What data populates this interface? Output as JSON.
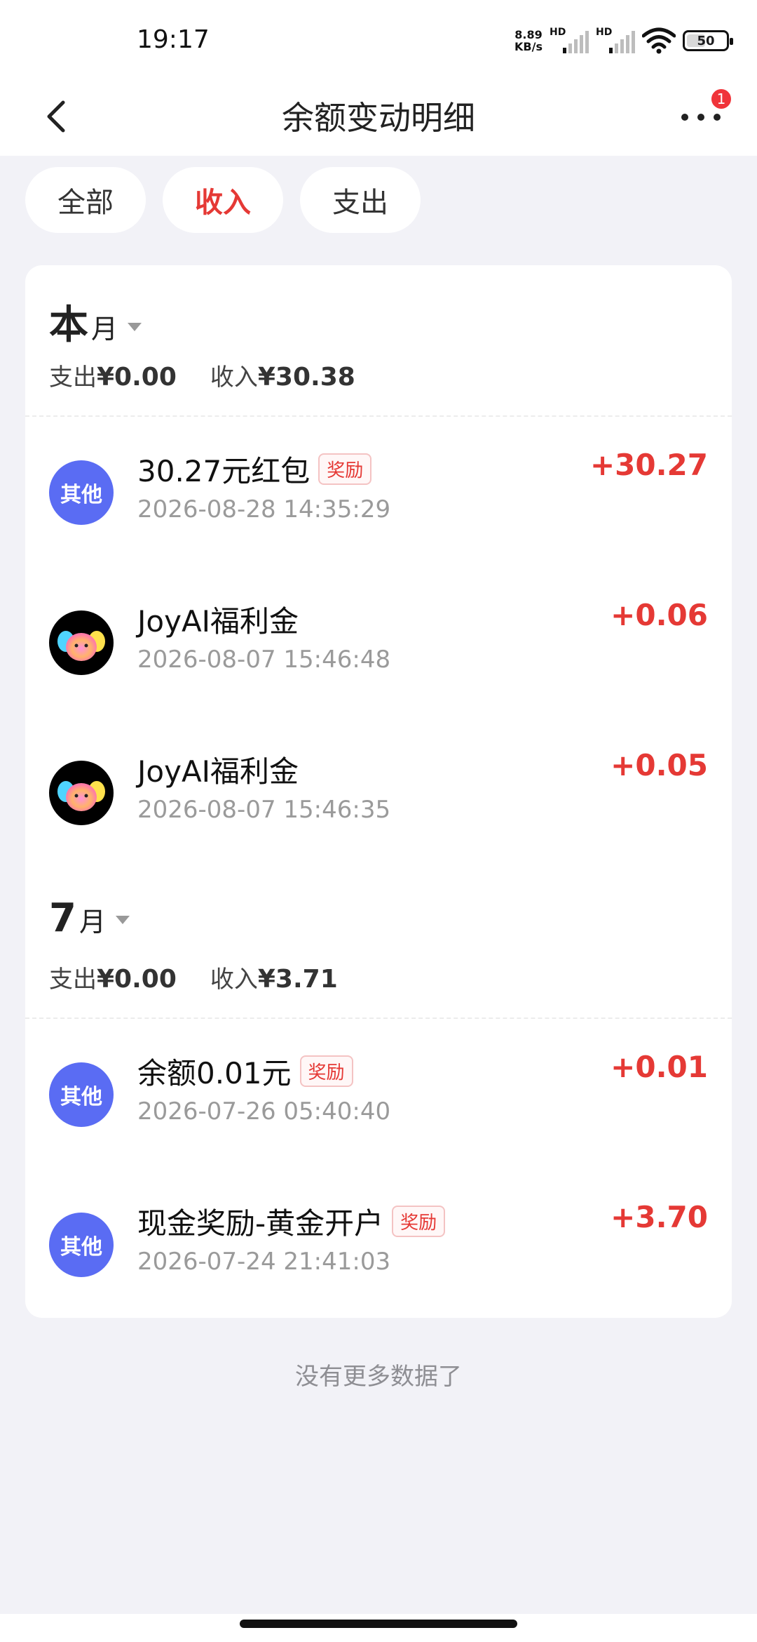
{
  "status": {
    "time": "19:17",
    "net_speed_value": "8.89",
    "net_speed_unit": "KB/s",
    "sim1_label": "HD",
    "sim2_label": "HD",
    "battery": "50"
  },
  "nav": {
    "title": "余额变动明细",
    "badge": "1"
  },
  "filters": [
    {
      "label": "全部"
    },
    {
      "label": "收入"
    },
    {
      "label": "支出"
    }
  ],
  "months": [
    {
      "big": "本",
      "suffix": "月",
      "expense_label": "支出",
      "expense_value": "¥0.00",
      "income_label": "收入",
      "income_value": "¥30.38"
    },
    {
      "big": "7",
      "suffix": "月",
      "expense_label": "支出",
      "expense_value": "¥0.00",
      "income_label": "收入",
      "income_value": "¥3.71"
    }
  ],
  "transactions": [
    {
      "avatar_text": "其他",
      "title": "30.27元红包",
      "tag": "奖励",
      "time": "2026-08-28 14:35:29",
      "amount": "+30.27"
    },
    {
      "avatar_text": "",
      "title": "JoyAI福利金",
      "tag": "",
      "time": "2026-08-07 15:46:48",
      "amount": "+0.06"
    },
    {
      "avatar_text": "",
      "title": "JoyAI福利金",
      "tag": "",
      "time": "2026-08-07 15:46:35",
      "amount": "+0.05"
    },
    {
      "avatar_text": "其他",
      "title": "余额0.01元",
      "tag": "奖励",
      "time": "2026-07-26 05:40:40",
      "amount": "+0.01"
    },
    {
      "avatar_text": "其他",
      "title": "现金奖励-黄金开户",
      "tag": "奖励",
      "time": "2026-07-24 21:41:03",
      "amount": "+3.70"
    }
  ],
  "footer": {
    "no_more": "没有更多数据了"
  },
  "colors": {
    "accent_red": "#E53935",
    "avatar_blue": "#5A6CF3",
    "background": "#F2F2F7"
  }
}
